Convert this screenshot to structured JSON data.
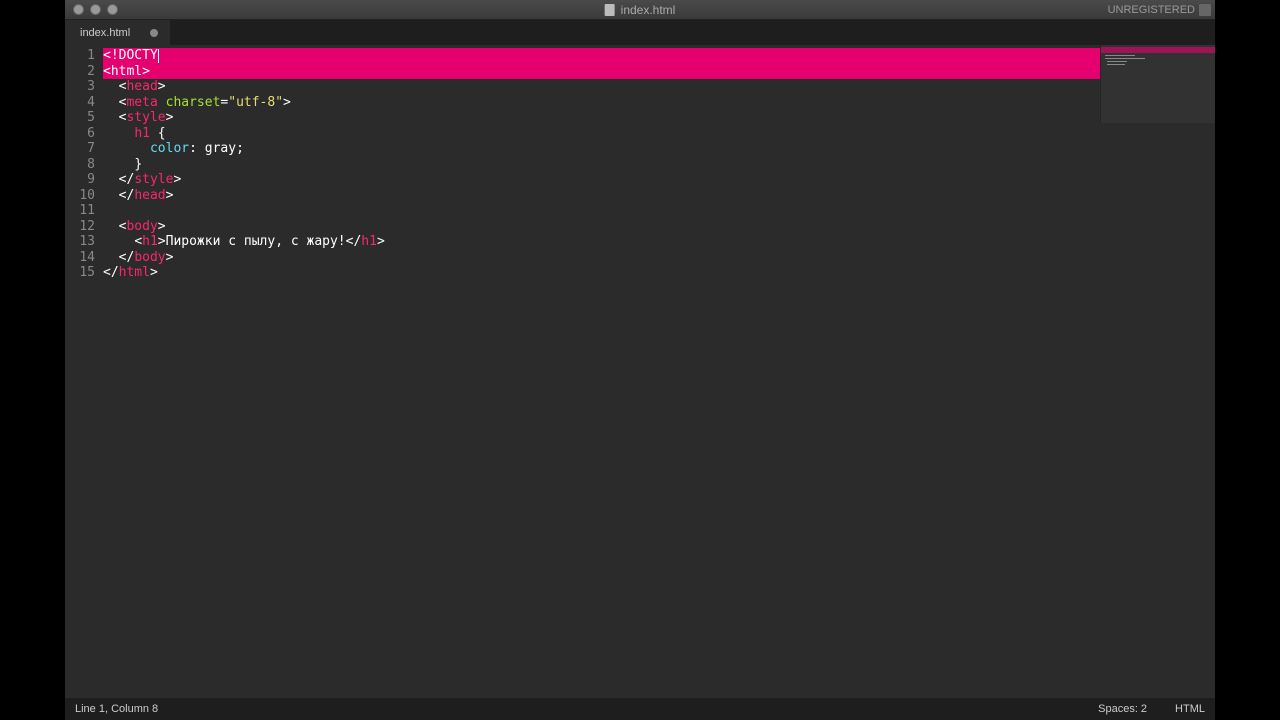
{
  "window": {
    "title": "index.html",
    "right_label": "UNREGISTERED"
  },
  "tabs": [
    {
      "label": "index.html",
      "dirty": true
    }
  ],
  "editor": {
    "line_numbers": [
      "1",
      "2",
      "3",
      "4",
      "5",
      "6",
      "7",
      "8",
      "9",
      "10",
      "11",
      "12",
      "13",
      "14",
      "15"
    ],
    "highlighted_rows": [
      0,
      1
    ],
    "code_lines": [
      {
        "indent": 0,
        "tokens": [
          {
            "cls": "highlight-text",
            "text": "<!DOCTY"
          }
        ],
        "caret_after": true
      },
      {
        "indent": 0,
        "tokens": [
          {
            "cls": "highlight-text",
            "text": "<html>"
          }
        ]
      },
      {
        "indent": 1,
        "tokens": [
          {
            "cls": "t-white",
            "text": "<"
          },
          {
            "cls": "t-tag",
            "text": "head"
          },
          {
            "cls": "t-white",
            "text": ">"
          }
        ]
      },
      {
        "indent": 1,
        "tokens": [
          {
            "cls": "t-white",
            "text": "<"
          },
          {
            "cls": "t-tag",
            "text": "meta"
          },
          {
            "cls": "t-white",
            "text": " "
          },
          {
            "cls": "t-attr",
            "text": "charset"
          },
          {
            "cls": "t-white",
            "text": "="
          },
          {
            "cls": "t-str",
            "text": "\"utf-8\""
          },
          {
            "cls": "t-white",
            "text": ">"
          }
        ]
      },
      {
        "indent": 1,
        "tokens": [
          {
            "cls": "t-white",
            "text": "<"
          },
          {
            "cls": "t-tag",
            "text": "style"
          },
          {
            "cls": "t-white",
            "text": ">"
          }
        ]
      },
      {
        "indent": 2,
        "tokens": [
          {
            "cls": "t-tag",
            "text": "h1"
          },
          {
            "cls": "t-white",
            "text": " {"
          }
        ]
      },
      {
        "indent": 3,
        "tokens": [
          {
            "cls": "t-prop",
            "text": "color"
          },
          {
            "cls": "t-white",
            "text": ": gray;"
          }
        ]
      },
      {
        "indent": 2,
        "tokens": [
          {
            "cls": "t-white",
            "text": "}"
          }
        ]
      },
      {
        "indent": 1,
        "tokens": [
          {
            "cls": "t-white",
            "text": "</"
          },
          {
            "cls": "t-tag",
            "text": "style"
          },
          {
            "cls": "t-white",
            "text": ">"
          }
        ]
      },
      {
        "indent": 1,
        "tokens": [
          {
            "cls": "t-white",
            "text": "</"
          },
          {
            "cls": "t-tag",
            "text": "head"
          },
          {
            "cls": "t-white",
            "text": ">"
          }
        ]
      },
      {
        "indent": 1,
        "tokens": []
      },
      {
        "indent": 1,
        "tokens": [
          {
            "cls": "t-white",
            "text": "<"
          },
          {
            "cls": "t-tag",
            "text": "body"
          },
          {
            "cls": "t-white",
            "text": ">"
          }
        ]
      },
      {
        "indent": 2,
        "tokens": [
          {
            "cls": "t-white",
            "text": "<"
          },
          {
            "cls": "t-tag",
            "text": "h1"
          },
          {
            "cls": "t-white",
            "text": ">Пирожки с пылу, с жару!</"
          },
          {
            "cls": "t-tag",
            "text": "h1"
          },
          {
            "cls": "t-white",
            "text": ">"
          }
        ]
      },
      {
        "indent": 1,
        "tokens": [
          {
            "cls": "t-white",
            "text": "</"
          },
          {
            "cls": "t-tag",
            "text": "body"
          },
          {
            "cls": "t-white",
            "text": ">"
          }
        ]
      },
      {
        "indent": 0,
        "tokens": [
          {
            "cls": "t-white",
            "text": "</"
          },
          {
            "cls": "t-tag",
            "text": "html"
          },
          {
            "cls": "t-white",
            "text": ">"
          }
        ]
      }
    ]
  },
  "statusbar": {
    "left": "Line 1, Column 8",
    "spaces": "Spaces: 2",
    "lang": "HTML"
  }
}
